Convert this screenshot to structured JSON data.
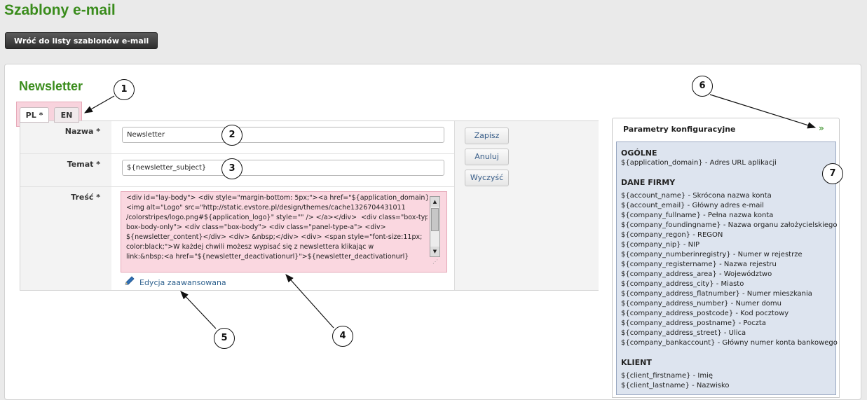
{
  "header": {
    "page_title": "Szablony e-mail",
    "back_button": "Wróć do listy szablonów e-mail"
  },
  "section": {
    "title": "Newsletter"
  },
  "tabs": [
    {
      "label": "PL *",
      "active": true
    },
    {
      "label": "EN",
      "active": false
    }
  ],
  "form": {
    "name_label": "Nazwa *",
    "name_value": "Newsletter",
    "subject_label": "Temat *",
    "subject_value": "${newsletter_subject}",
    "content_label": "Treść *",
    "content_lines": [
      "<div id=\"lay-body\"> <div style=\"margin-bottom: 5px;\"><a href=\"${application_domain}\">",
      "<img alt=\"Logo\" src=\"http://static.evstore.pl/design/themes/cache1326704431011",
      "/colorstripes/logo.png#${application_logo}\" style=\"\" /> </a></div>  <div class=\"box-type-b",
      "box-body-only\"> <div class=\"box-body\"> <div class=\"panel-type-a\"> <div>",
      "${newsletter_content}</div> <div> &nbsp;</div> <div> <span style=\"font-size:11px;",
      "color:black;\">W każdej chwili możesz wypisać się z newslettera klikając w",
      "link:&nbsp;<a href=\"${newsletter_deactivationurl}\">${newsletter_deactivationurl}"
    ],
    "advanced_edit_link": "Edycja zaawansowana"
  },
  "actions": {
    "save": "Zapisz",
    "cancel": "Anuluj",
    "clear": "Wyczyść"
  },
  "config_panel": {
    "title": "Parametry konfiguracyjne",
    "sections": [
      {
        "heading": "OGÓLNE",
        "items": [
          "${application_domain} - Adres URL aplikacji"
        ]
      },
      {
        "heading": "DANE FIRMY",
        "items": [
          "${account_name} - Skrócona nazwa konta",
          "${account_email} - Główny adres e-mail",
          "${company_fullname} - Pełna nazwa konta",
          "${company_foundingname} - Nazwa organu założycielskiego",
          "${company_regon} - REGON",
          "${company_nip} - NIP",
          "${company_numberinregistry} - Numer w rejestrze",
          "${company_registername} - Nazwa rejestru",
          "${company_address_area} - Województwo",
          "${company_address_city} - Miasto",
          "${company_address_flatnumber} - Numer mieszkania",
          "${company_address_number} - Numer domu",
          "${company_address_postcode} - Kod pocztowy",
          "${company_address_postname} - Poczta",
          "${company_address_street} - Ulica",
          "${company_bankaccount} - Główny numer konta bankowego"
        ]
      },
      {
        "heading": "KLIENT",
        "items": [
          "${client_firstname} - Imię",
          "${client_lastname} - Nazwisko"
        ]
      }
    ]
  },
  "callouts": [
    "1",
    "2",
    "3",
    "4",
    "5",
    "6",
    "7"
  ],
  "colors": {
    "brand_green": "#3a8c1c",
    "highlight_pink": "#fad7e0",
    "panel_blue": "#dde4ef",
    "link_blue": "#2c5f8c"
  },
  "icons": [
    "pencil-icon",
    "collapse-chevron-icon",
    "scroll-up-arrow-icon",
    "scroll-down-arrow-icon"
  ]
}
